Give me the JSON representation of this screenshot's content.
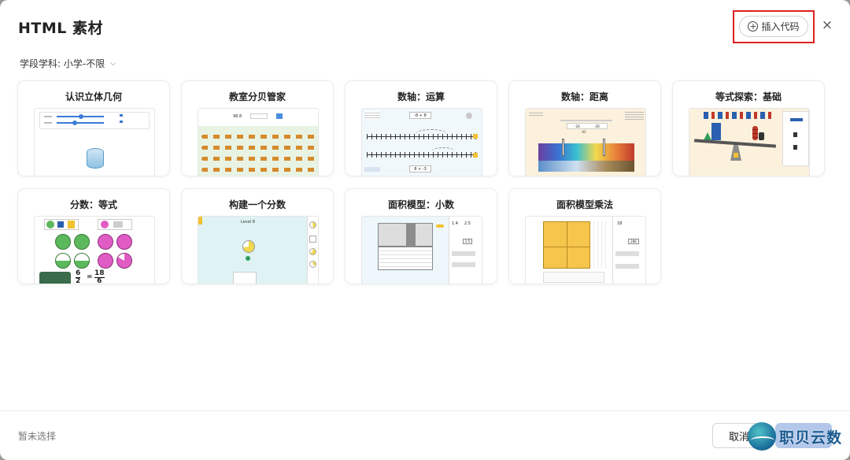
{
  "dialog": {
    "title": "HTML 素材",
    "insert_label": "插入代码",
    "close_glyph": "×",
    "filter_label": "学段学科: 小学-不限",
    "no_selection": "暂未选择",
    "cancel_label": "取消",
    "watermark": "职贝云数"
  },
  "cards": [
    {
      "title": "认识立体几何"
    },
    {
      "title": "教室分贝管家"
    },
    {
      "title": "数轴：运算"
    },
    {
      "title": "数轴：距离"
    },
    {
      "title": "等式探索：基础"
    },
    {
      "title": "分数：等式"
    },
    {
      "title": "构建一个分数"
    },
    {
      "title": "面积模型：小数"
    },
    {
      "title": "面积模型乘法"
    }
  ],
  "thumbs": {
    "decibel_value": "98.8",
    "numline_ops": [
      "-8 + 8",
      "8 + -3"
    ],
    "distance_values": [
      "-26",
      "-26",
      "-41"
    ],
    "fraction_eq": [
      "6",
      "2",
      "18",
      "6"
    ],
    "level_label": "Level 8",
    "decimal_expr": [
      "1.4",
      "2.5",
      "3.5"
    ],
    "mult_expr": [
      "18",
      "286"
    ]
  },
  "colors": {
    "highlight": "#e02020",
    "confirm_bg": "#b3c7ea",
    "watermark": "#1a5a8e"
  }
}
